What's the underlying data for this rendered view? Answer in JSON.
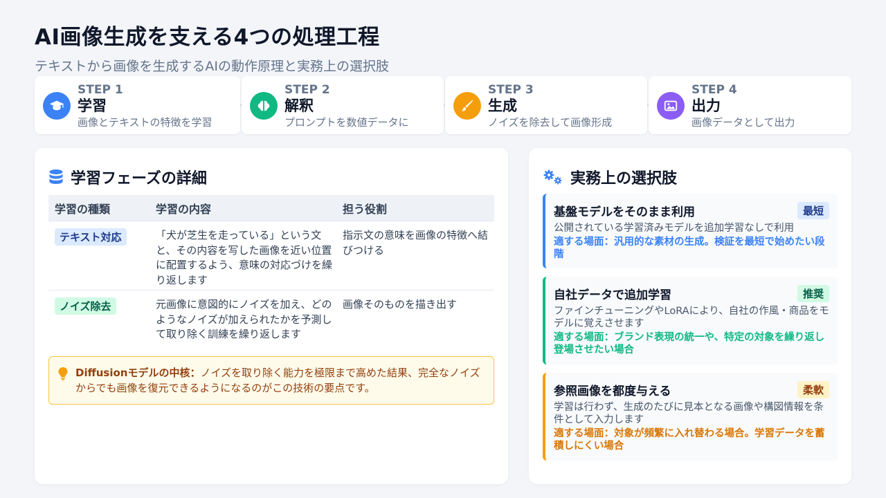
{
  "header": {
    "title": "AI画像生成を支える4つの処理工程",
    "subtitle": "テキストから画像を生成するAIの動作原理と実務上の選択肢"
  },
  "steps": [
    {
      "num": "STEP 1",
      "name": "学習",
      "desc": "画像とテキストの特徴を学習",
      "icon": "graduation-cap-icon",
      "color": "#3b82f6"
    },
    {
      "num": "STEP 2",
      "name": "解釈",
      "desc": "プロンプトを数値データに",
      "icon": "brain-icon",
      "color": "#10b981"
    },
    {
      "num": "STEP 3",
      "name": "生成",
      "desc": "ノイズを除去して画像形成",
      "icon": "paintbrush-icon",
      "color": "#f59e0b"
    },
    {
      "num": "STEP 4",
      "name": "出力",
      "desc": "画像データとして出力",
      "icon": "image-icon",
      "color": "#8b5cf6"
    }
  ],
  "learning": {
    "title": "学習フェーズの詳細",
    "icon": "database-icon",
    "columns": [
      "学習の種類",
      "学習の内容",
      "担う役割"
    ],
    "rows": [
      {
        "type": "テキスト対応",
        "content": "「犬が芝生を走っている」という文と、その内容を写した画像を近い位置に配置するよう、意味の対応づけを繰り返します",
        "role": "指示文の意味を画像の特徴へ結びつける"
      },
      {
        "type": "ノイズ除去",
        "content": "元画像に意図的にノイズを加え、どのようなノイズが加えられたかを予測して取り除く訓練を繰り返します",
        "role": "画像そのものを描き出す"
      }
    ],
    "note": {
      "icon": "lightbulb-icon",
      "label": "Diffusionモデルの中核：",
      "text": "ノイズを取り除く能力を極限まで高めた結果、完全なノイズからでも画像を復元できるようになるのがこの技術の要点です。"
    }
  },
  "options": {
    "title": "実務上の選択肢",
    "icon": "gears-icon",
    "cards": [
      {
        "title": "基盤モデルをそのまま利用",
        "badge": "最短",
        "desc": "公開されている学習済みモデルを追加学習なしで利用",
        "fit": "適する場面：汎用的な素材の生成。検証を最短で始めたい段階",
        "color": "#3b82f6",
        "badge_bg": "#dbeafe",
        "badge_fg": "#1e3a8a"
      },
      {
        "title": "自社データで追加学習",
        "badge": "推奨",
        "desc": "ファインチューニングやLoRAにより、自社の作風・商品をモデルに覚えさせます",
        "fit": "適する場面：ブランド表現の統一や、特定の対象を繰り返し登場させたい場合",
        "color": "#10b981",
        "badge_bg": "#d1fae5",
        "badge_fg": "#065f46"
      },
      {
        "title": "参照画像を都度与える",
        "badge": "柔軟",
        "desc": "学習は行わず、生成のたびに見本となる画像や構図情報を条件として入力します",
        "fit": "適する場面：対象が頻繁に入れ替わる場合。学習データを蓄積しにくい場合",
        "color": "#f59e0b",
        "badge_bg": "#fef3c7",
        "badge_fg": "#92400e"
      }
    ]
  }
}
